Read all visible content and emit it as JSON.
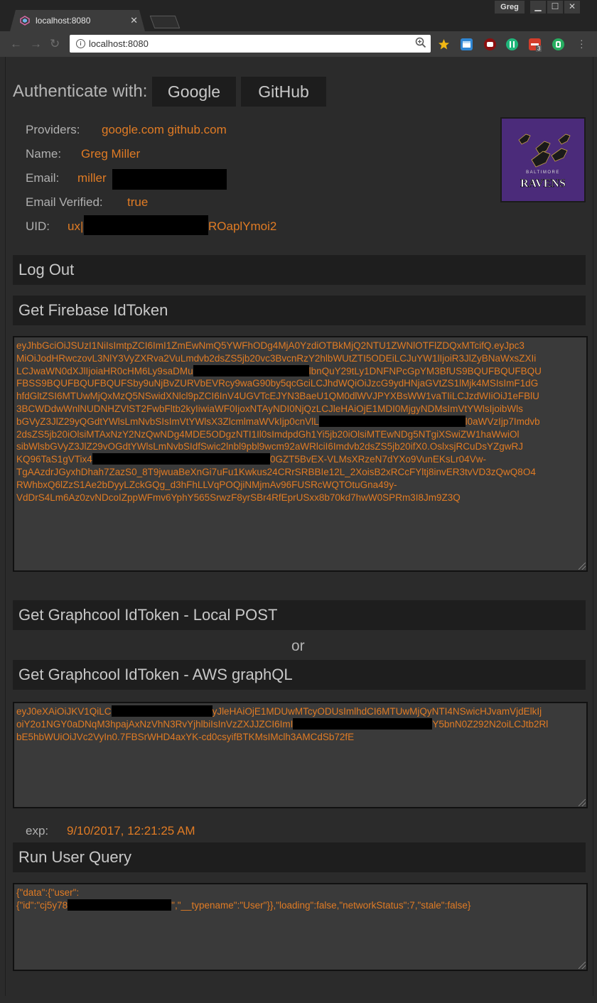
{
  "browser": {
    "tab_title": "localhost:8080",
    "tab_close": "✕",
    "profile_name": "Greg",
    "url": "localhost:8080",
    "window_minimize": "▁",
    "window_maximize": "☐",
    "window_close": "✕",
    "nav_back": "←",
    "nav_forward": "→",
    "nav_reload": "↻",
    "info_glyph": "i",
    "extension_badge": "3"
  },
  "auth": {
    "label": "Authenticate with:",
    "google": "Google",
    "github": "GitHub"
  },
  "profile": {
    "providers_label": "Providers:",
    "providers_value": "google.com github.com",
    "name_label": "Name:",
    "name_value": "Greg Miller",
    "email_label": "Email:",
    "email_value": "miller",
    "email_verified_label": "Email Verified:",
    "email_verified_value": "true",
    "uid_label": "UID:",
    "uid_prefix": "ux|",
    "uid_suffix": "ROaplYmoi2",
    "avatar_text": "RAVENS",
    "avatar_subtext": "BALTIMORE"
  },
  "buttons": {
    "logout": "Log Out",
    "firebase": "Get Firebase IdToken",
    "graphcool_local": "Get Graphcool IdToken - Local POST",
    "or": "or",
    "graphcool_aws": "Get Graphcool IdToken - AWS graphQL",
    "run_query": "Run User Query"
  },
  "firebase_token": {
    "l1": "eyJhbGciOiJSUzI1NiIsImtpZCI6ImI1ZmEwNmQ5YWFhODg4MjA0YzdiOTBkMjQ2NTU1ZWNlOTFlZDQxMTcifQ.eyJpc3",
    "l2": "MiOiJodHRwczovL3NlY3VyZXRva2VuLmdvb2dsZS5jb20vc3BvcnRzY2hlbWUtZTI5ODEiLCJuYW1lIjoiR3JlZyBNaWxsZXIi",
    "l3a": "LCJwaWN0dXJlIjoiaHR0cHM6Ly9saDMu",
    "l3b": "lbnQuY29tLy1DNFNPcGpYM3BfUS9BQUFBQUFBQU",
    "l4": "FBSS9BQUFBQUFBQUFSby9uNjBvZURVbEVRcy9waG90by5qcGciLCJhdWQiOiJzcG9ydHNjaGVtZS1lMjk4MSIsImF1dG",
    "l5": "hfdGltZSI6MTUwMjQxMzQ5NSwidXNlcl9pZCI6InV4UGVTcEJYN3BaeU1QM0dlWVJPYXBsWW1vaTIiLCJzdWIiOiJ1eFBlU",
    "l6": "3BCWDdwWnlNUDNHZVlST2FwbFltb2kyIiwiaWF0IjoxNTAyNDI0NjQzLCJleHAiOjE1MDI0MjgyNDMsImVtYWlsIjoibWls",
    "l7a": "bGVyZ3JlZ29yQGdtYWlsLmNvbSIsImVtYWlsX3ZlcmlmaWVkIjp0cnVlL",
    "l7b": "l0aWVzIjp7Imdvb",
    "l8": "2dsZS5jb20iOlsiMTAxNzY2NzQwNDg4MDE5ODgzNTI1Il0sImdpdGh1Yi5jb20iOlsiMTEwNDg5NTgiXSwiZW1haWwiOl",
    "l9": "sibWlsbGVyZ3JlZ29vOGdtYWlsLmNvbSIdfSwic2lnbl9pbl9wcm92aWRlciI6Imdvb2dsZS5jb20ifX0.OslxsjRCuDsYZgwRJ",
    "l10a": "KQ96TaS1gVTix4",
    "l10b": "0GZT5BvEX-VLMsXRzeN7dYXo9VunEKsLr04Vw-",
    "l11": "TgAAzdrJGyxhDhah7ZazS0_8T9jwuaBeXnGi7uFu1Kwkus24CRrSRBBIe12L_2XoisB2xRCcFYltj8invER3tvVD3zQwQ8O4",
    "l12": "RWhbxQ6lZzS1Ae2bDyyLZckGQg_d3hFhLLVqPOQjiNMjmAv96FUSRcWQTOtuGna49y-",
    "l13": "VdDrS4Lm6Az0zvNDcoIZppWFmv6YphY565SrwzF8yrSBr4RfEprUSxx8b70kd7hwW0SPRm3I8Jm9Z3Q"
  },
  "graphcool_token": {
    "l1a": "eyJ0eXAiOiJKV1QiLC",
    "l1b": "yJleHAiOjE1MDUwMTcyODUsImlhdCI6MTUwMjQyNTI4NSwicHJvamVjdElkIj",
    "l2a": "oiY2o1NGY0aDNqM3hpajAxNzVhN3RvYjhlbiIsInVzZXJJZCI6ImI",
    "l2b": "Y5bnN0Z292N2oiLCJtb2Rl",
    "l3": "bE5hbWUiOiJVc2VyIn0.7FBSrWHD4axYK-cd0csyifBTKMsIMclh3AMCdSb72fE"
  },
  "exp": {
    "label": "exp:",
    "value": "9/10/2017, 12:21:25 AM"
  },
  "query_result": {
    "l1": "{\"data\":{\"user\":",
    "l2a": "{\"id\":\"cj5y78",
    "l2b": "\",\"__typename\":\"User\"}},\"loading\":false,\"networkStatus\":7,\"stale\":false}"
  },
  "colors": {
    "accent": "#e07b24",
    "page_bg": "#2b2b2b",
    "button_bg": "#1e1e1e"
  }
}
